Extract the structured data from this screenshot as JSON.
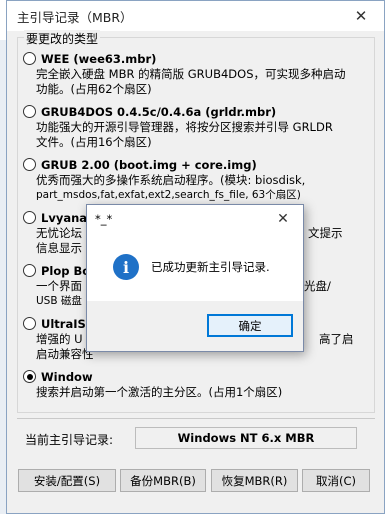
{
  "window": {
    "title": "主引导记录（MBR）",
    "close_glyph": "✕"
  },
  "group": {
    "title": "要更改的类型",
    "options": [
      {
        "label": "WEE (wee63.mbr)",
        "checked": false,
        "desc": [
          "完全嵌入硬盘 MBR 的精简版 GRUB4DOS，可实现多种启动",
          "功能。(占用62个扇区)"
        ]
      },
      {
        "label": "GRUB4DOS 0.4.5c/0.4.6a (grldr.mbr)",
        "checked": false,
        "desc": [
          "功能强大的开源引导管理器，将按分区搜索并引导 GRLDR",
          "文件。(占用16个扇区)"
        ]
      },
      {
        "label": "GRUB 2.00 (boot.img + core.img)",
        "checked": false,
        "desc": [
          "优秀而强大的多操作系统启动程序。(模块: biosdisk,",
          "part_msdos,fat,exfat,ext2,search_fs_file, 63个扇区)"
        ]
      },
      {
        "label": "Lvyanan",
        "checked": false,
        "desc": [
          "无忧论坛",
          "信息显示"
        ],
        "desc_right": [
          "文提示",
          ""
        ]
      },
      {
        "label": "Plop Bo",
        "checked": false,
        "desc": [
          "一个界面",
          "USB 磁盘"
        ],
        "desc_right": [
          "光盘/",
          ""
        ]
      },
      {
        "label": "UltraISO",
        "checked": false,
        "desc": [
          "增强的 U",
          "启动兼容性"
        ],
        "desc_right": [
          "高了启",
          ""
        ]
      },
      {
        "label": "Window",
        "checked": true,
        "desc": [
          "搜索并启动第一个激活的主分区。(占用1个扇区)"
        ]
      }
    ]
  },
  "current_mbr": {
    "label": "当前主引导记录:",
    "value": "Windows NT 6.x MBR"
  },
  "buttons": {
    "install": "安装/配置(S)",
    "backup": "备份MBR(B)",
    "restore": "恢复MBR(R)",
    "cancel": "取消(C)"
  },
  "dialog": {
    "title": "*_*",
    "close_glyph": "✕",
    "icon_glyph": "i",
    "message": "已成功更新主引导记录.",
    "ok_label": "确定"
  },
  "colors": {
    "accent": "#0078d7",
    "info_icon": "#1f71c7"
  }
}
